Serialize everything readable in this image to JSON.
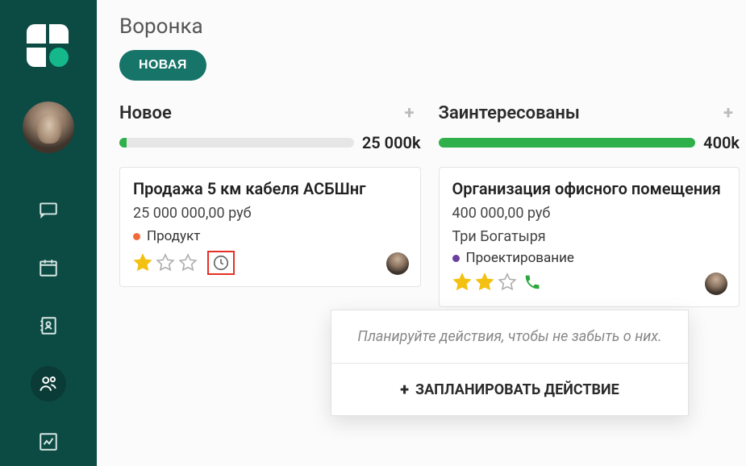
{
  "header": {
    "page_title": "Воронка",
    "new_button_label": "НОВАЯ"
  },
  "columns": [
    {
      "title": "Новое",
      "total": "25 000k",
      "progress_pct": 3,
      "cards": [
        {
          "title": "Продажа 5 км кабеля АСБШнг",
          "amount": "25 000 000,00 руб",
          "tag": "Продукт",
          "tag_color": "orange",
          "stars": 1,
          "has_clock": true,
          "clock_highlighted": true,
          "has_phone": false
        }
      ]
    },
    {
      "title": "Заинтересованы",
      "total": "400k",
      "progress_pct": 100,
      "cards": [
        {
          "title": "Организация офисного помещения",
          "amount": "400 000,00 руб",
          "company": "Три Богатыря",
          "tag": "Проектирование",
          "tag_color": "purple",
          "stars": 2,
          "has_clock": false,
          "has_phone": true
        }
      ]
    }
  ],
  "popover": {
    "hint": "Планируйте действия, чтобы не забыть о них.",
    "action_label": "ЗАПЛАНИРОВАТЬ ДЕЙСТВИЕ"
  },
  "sidebar_items": [
    "messages",
    "calendar",
    "contacts-book",
    "people",
    "reports"
  ],
  "sidebar_active_index": 3
}
